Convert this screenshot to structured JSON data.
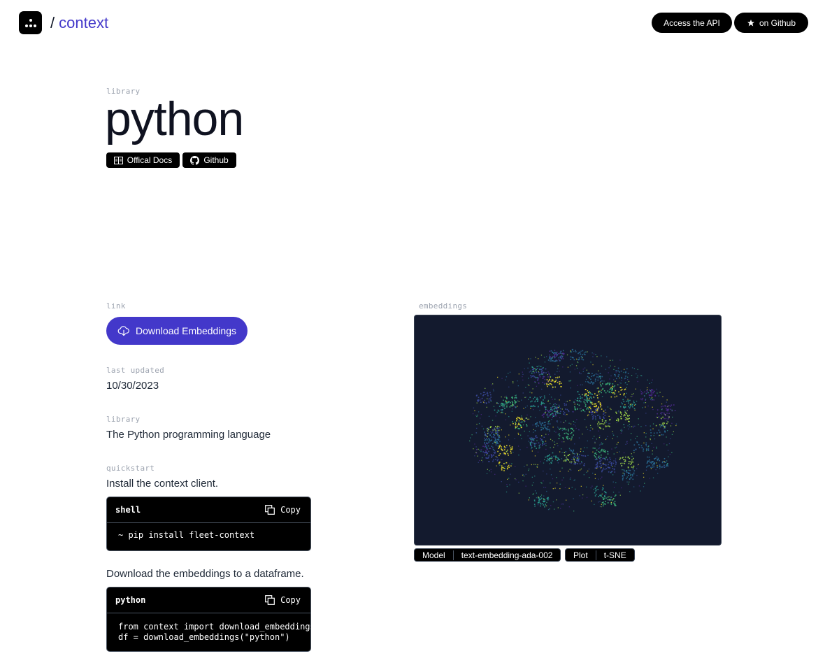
{
  "header": {
    "brand_slash": "/",
    "brand_name": "context",
    "api_button": "Access the API",
    "github_button": "on Github"
  },
  "library_section": {
    "label": "library",
    "title": "python",
    "docs_chip": "Offical Docs",
    "github_chip": "Github"
  },
  "link": {
    "label": "link",
    "download_button": "Download Embeddings"
  },
  "last_updated": {
    "label": "last updated",
    "value": "10/30/2023"
  },
  "library_info": {
    "label": "library",
    "value": "The Python programming language"
  },
  "quickstart": {
    "label": "quickstart",
    "step1": "Install the context client.",
    "shell_lang": "shell",
    "shell_copy": "Copy",
    "shell_code": "~ pip install fleet-context",
    "step2": "Download the embeddings to a dataframe.",
    "python_lang": "python",
    "python_copy": "Copy",
    "python_code": "from context import download_embeddings\ndf = download_embeddings(\"python\")"
  },
  "embeddings": {
    "label": "embeddings",
    "model_key": "Model",
    "model_value": "text-embedding-ada-002",
    "plot_key": "Plot",
    "plot_value": "t-SNE",
    "colors": [
      "#f5e62a",
      "#a6e04a",
      "#3fbf7f",
      "#2a9d8f",
      "#2a6f97",
      "#3b4a9c",
      "#4f2a8f"
    ],
    "background": "#131a2e"
  },
  "icons": {
    "logo": "dots-triangle-logo",
    "star": "star-icon",
    "docs": "book-icon",
    "github": "github-icon",
    "download": "cloud-download-icon",
    "copy": "copy-icon"
  },
  "accent_color": "#4338ca"
}
